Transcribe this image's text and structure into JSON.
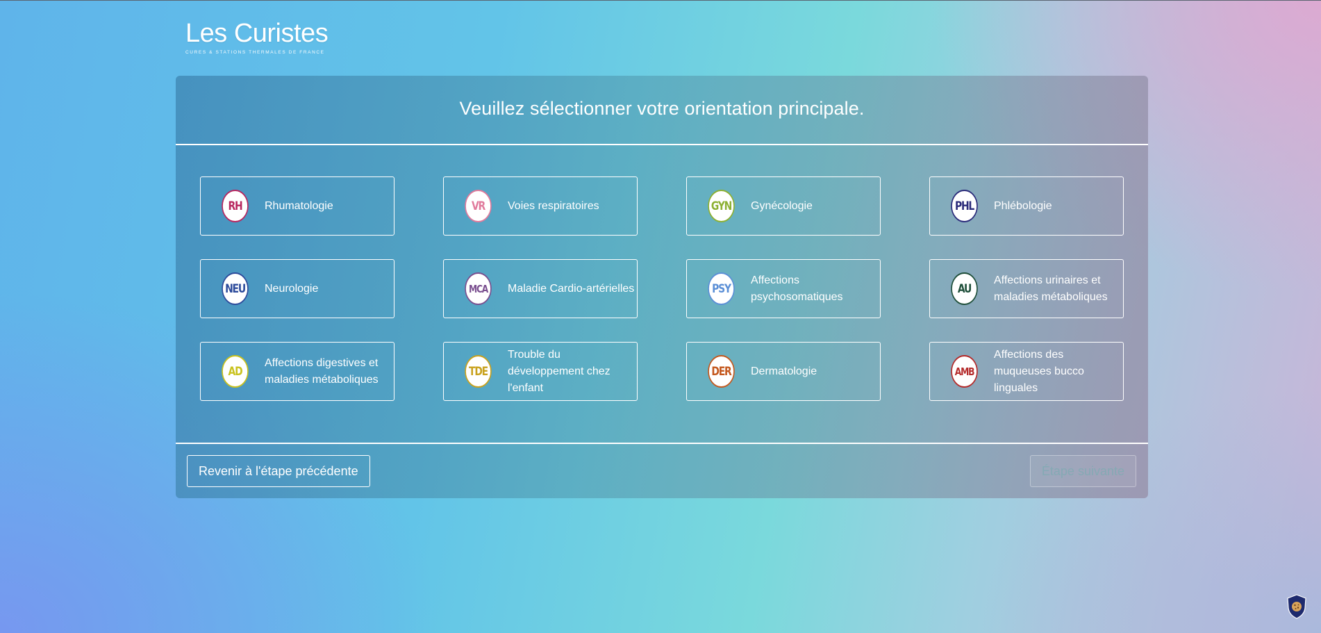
{
  "brand": {
    "name": "Les Curistes",
    "tagline": "CURES & STATIONS THERMALES DE FRANCE"
  },
  "page": {
    "title": "Veuillez sélectionner votre orientation principale."
  },
  "orientations": [
    {
      "code": "RH",
      "label": "Rhumatologie",
      "color": "#b8265f"
    },
    {
      "code": "VR",
      "label": "Voies respiratoires",
      "color": "#e07a9c"
    },
    {
      "code": "GYN",
      "label": "Gynécologie",
      "color": "#8cb032"
    },
    {
      "code": "PHL",
      "label": "Phlébologie",
      "color": "#2b2b7a"
    },
    {
      "code": "NEU",
      "label": "Neurologie",
      "color": "#2d4b9b"
    },
    {
      "code": "MCA",
      "label": "Maladie Cardio-artérielles",
      "color": "#7a4f8f"
    },
    {
      "code": "PSY",
      "label": "Affections psychosomatiques",
      "color": "#5b8fd6"
    },
    {
      "code": "AU",
      "label": "Affections urinaires et maladies métaboliques",
      "color": "#1f4f3a"
    },
    {
      "code": "AD",
      "label": "Affections digestives et maladies métaboliques",
      "color": "#c9c21e"
    },
    {
      "code": "TDE",
      "label": "Trouble du développement chez l'enfant",
      "color": "#c9a21e"
    },
    {
      "code": "DER",
      "label": "Dermatologie",
      "color": "#c4581e"
    },
    {
      "code": "AMB",
      "label": "Affections des muqueuses bucco linguales",
      "color": "#b52b2b"
    }
  ],
  "footer": {
    "prev_label": "Revenir à l'étape précédente",
    "next_label": "Étape suivante"
  },
  "cookie_widget": {
    "icon": "cookie-shield-icon",
    "color": "#1e2a6e"
  }
}
